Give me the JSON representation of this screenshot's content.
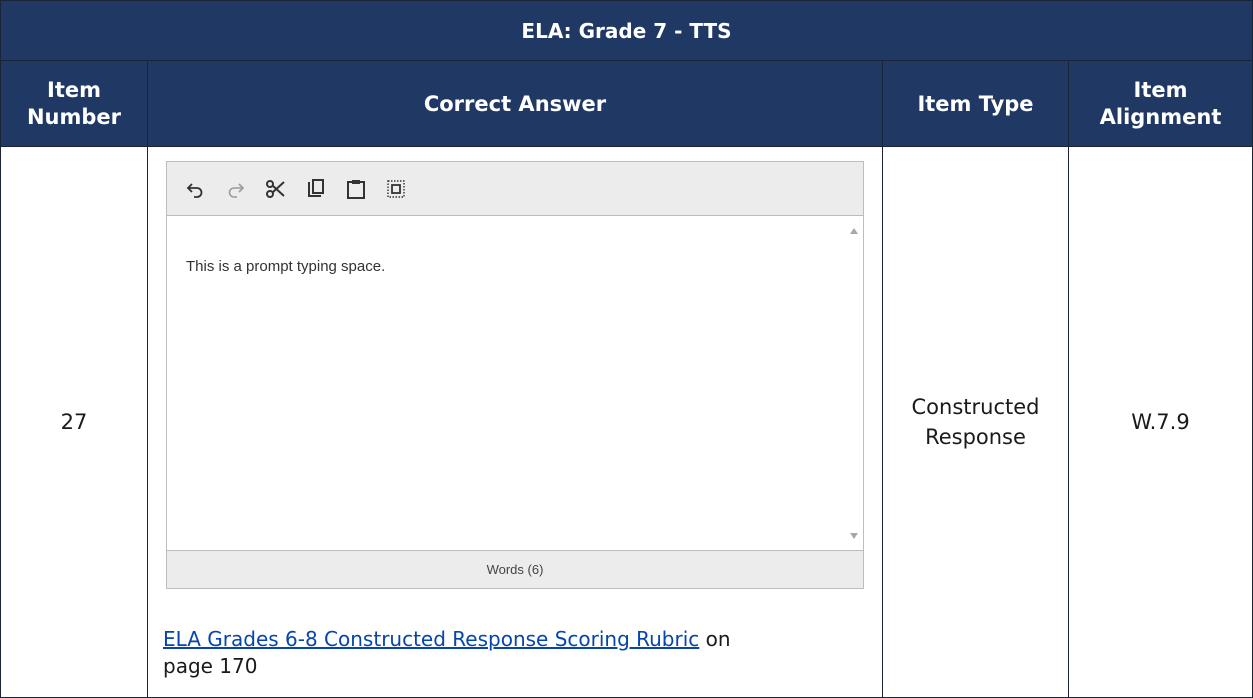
{
  "table": {
    "title": "ELA: Grade 7 - TTS",
    "headers": {
      "item_number_line1": "Item",
      "item_number_line2": "Number",
      "correct_answer": "Correct Answer",
      "item_type": "Item Type",
      "item_alignment_line1": "Item",
      "item_alignment_line2": "Alignment"
    },
    "row": {
      "item_number": "27",
      "item_type_line1": "Constructed",
      "item_type_line2": "Response",
      "item_alignment": "W.7.9"
    }
  },
  "editor": {
    "toolbar": {
      "undo_icon": "undo-icon",
      "redo_icon": "redo-icon",
      "cut_icon": "scissors-icon",
      "copy_icon": "copy-icon",
      "paste_icon": "clipboard-icon",
      "select_all_icon": "select-all-icon"
    },
    "text": "This is a prompt typing space.",
    "word_count": "Words (6)"
  },
  "rubric": {
    "link_text": "ELA Grades 6-8 Constructed Response Scoring Rubric",
    "suffix_line1": " on",
    "suffix_line2": "page 170"
  },
  "colors": {
    "header_bg": "#203864",
    "header_text": "#ffffff",
    "link": "#0645ad"
  }
}
